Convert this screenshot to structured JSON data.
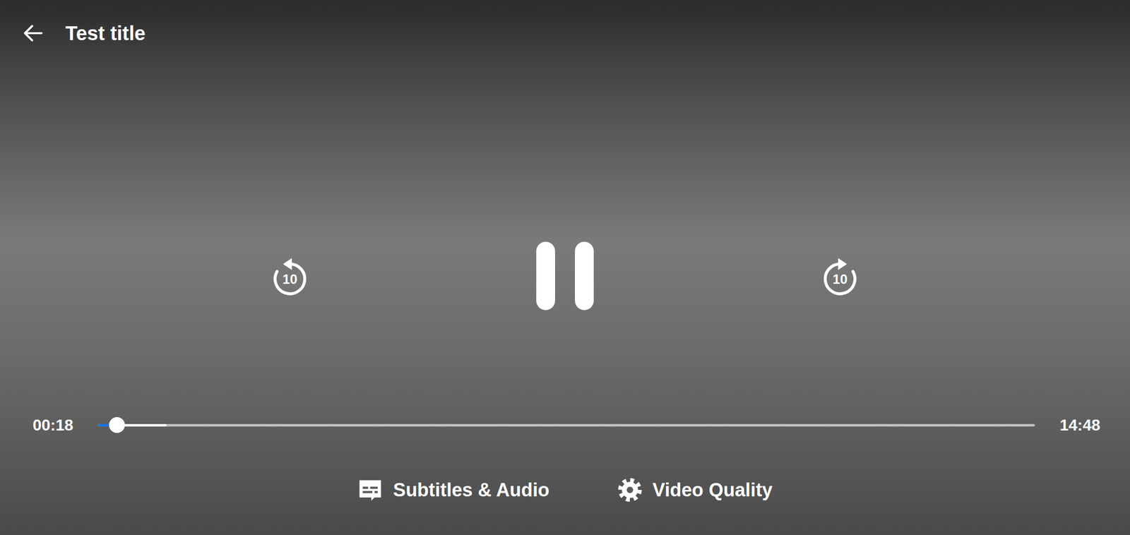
{
  "header": {
    "title": "Test title"
  },
  "controls": {
    "rewind": {
      "label": "10"
    },
    "forward": {
      "label": "10"
    },
    "playing": true
  },
  "seek": {
    "elapsed": "00:18",
    "duration": "14:48",
    "level": 0.02,
    "buffered_level": 0.073
  },
  "buttons": [
    {
      "label": "Subtitles & Audio",
      "kind": "subtitles"
    },
    {
      "label": "Video Quality",
      "kind": "quality"
    }
  ]
}
